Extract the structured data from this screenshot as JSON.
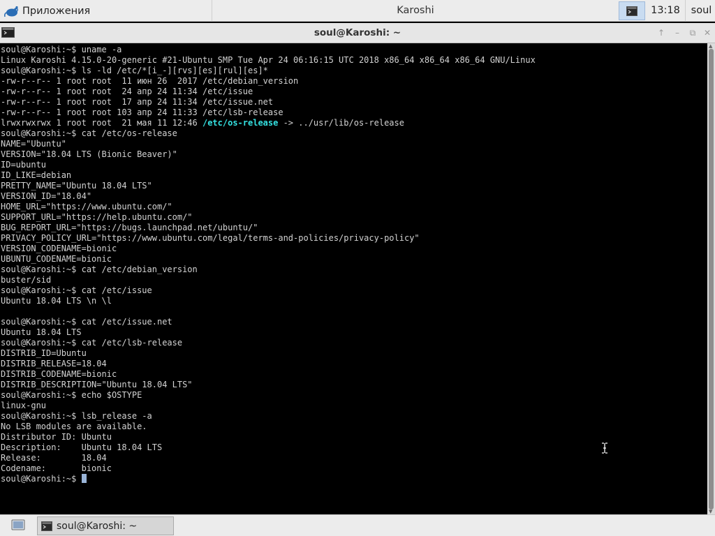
{
  "top_panel": {
    "apps_label": "Приложения",
    "center_title": "Karoshi",
    "clock": "13:18",
    "user": "soul"
  },
  "window": {
    "title": "soul@Karoshi: ~",
    "buttons": [
      "up",
      "minimize",
      "restore",
      "close"
    ]
  },
  "terminal": {
    "prompt": "soul@Karoshi:~$ ",
    "highlight_color": "#34e2e2",
    "lines": [
      "soul@Karoshi:~$ uname -a",
      "Linux Karoshi 4.15.0-20-generic #21-Ubuntu SMP Tue Apr 24 06:16:15 UTC 2018 x86_64 x86_64 x86_64 GNU/Linux",
      "soul@Karoshi:~$ ls -ld /etc/*[i_-][rvs][es][rul][es]*",
      "-rw-r--r-- 1 root root  11 июн 26  2017 /etc/debian_version",
      "-rw-r--r-- 1 root root  24 апр 24 11:34 /etc/issue",
      "-rw-r--r-- 1 root root  17 апр 24 11:34 /etc/issue.net",
      "-rw-r--r-- 1 root root 103 апр 24 11:33 /etc/lsb-release",
      "lrwxrwxrwx 1 root root  21 мая 11 12:46 ",
      "soul@Karoshi:~$ cat /etc/os-release",
      "NAME=\"Ubuntu\"",
      "VERSION=\"18.04 LTS (Bionic Beaver)\"",
      "ID=ubuntu",
      "ID_LIKE=debian",
      "PRETTY_NAME=\"Ubuntu 18.04 LTS\"",
      "VERSION_ID=\"18.04\"",
      "HOME_URL=\"https://www.ubuntu.com/\"",
      "SUPPORT_URL=\"https://help.ubuntu.com/\"",
      "BUG_REPORT_URL=\"https://bugs.launchpad.net/ubuntu/\"",
      "PRIVACY_POLICY_URL=\"https://www.ubuntu.com/legal/terms-and-policies/privacy-policy\"",
      "VERSION_CODENAME=bionic",
      "UBUNTU_CODENAME=bionic",
      "soul@Karoshi:~$ cat /etc/debian_version",
      "buster/sid",
      "soul@Karoshi:~$ cat /etc/issue",
      "Ubuntu 18.04 LTS \\n \\l",
      "",
      "soul@Karoshi:~$ cat /etc/issue.net",
      "Ubuntu 18.04 LTS",
      "soul@Karoshi:~$ cat /etc/lsb-release",
      "DISTRIB_ID=Ubuntu",
      "DISTRIB_RELEASE=18.04",
      "DISTRIB_CODENAME=bionic",
      "DISTRIB_DESCRIPTION=\"Ubuntu 18.04 LTS\"",
      "soul@Karoshi:~$ echo $OSTYPE",
      "linux-gnu",
      "soul@Karoshi:~$ lsb_release -a",
      "No LSB modules are available.",
      "Distributor ID:\tUbuntu",
      "Description:\tUbuntu 18.04 LTS",
      "Release:\t18.04",
      "Codename:\tbionic",
      "soul@Karoshi:~$ "
    ],
    "symlink_name": "/etc/os-release",
    "symlink_target": " -> ../usr/lib/os-release"
  },
  "taskbar": {
    "task_label": "soul@Karoshi: ~"
  }
}
